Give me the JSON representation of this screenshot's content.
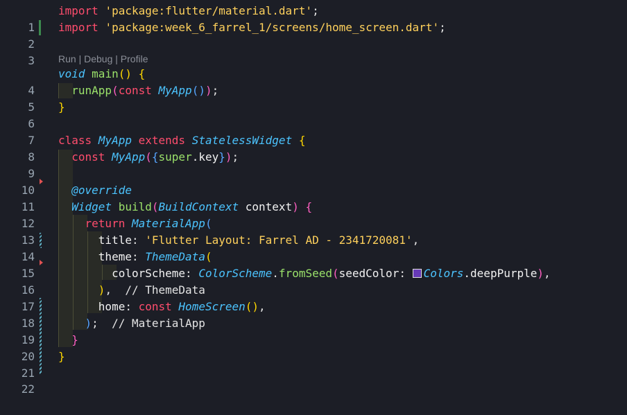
{
  "editor": {
    "line_numbers": [
      "1",
      "2",
      "3",
      "4",
      "5",
      "6",
      "7",
      "8",
      "9",
      "10",
      "11",
      "12",
      "13",
      "14",
      "15",
      "16",
      "17",
      "18",
      "19",
      "20",
      "21",
      "22"
    ],
    "code_lens": {
      "run": "Run",
      "sep1": " | ",
      "debug": "Debug",
      "sep2": " | ",
      "profile": "Profile"
    },
    "tokens": {
      "l1_import": "import",
      "l1_str": "'package:flutter/material.dart'",
      "l1_semi": ";",
      "l2_import": "import",
      "l2_str": "'package:week_6_farrel_1/screens/home_screen.dart'",
      "l2_semi": ";",
      "l4_void": "void",
      "l4_main": "main",
      "l4_parens": "()",
      "l4_brace": "{",
      "l5_runapp": "runApp",
      "l5_p_open": "(",
      "l5_const": "const",
      "l5_myapp": "MyApp",
      "l5_inner": "()",
      "l5_p_close": ")",
      "l5_semi": ";",
      "l6_brace": "}",
      "l8_class": "class",
      "l8_myapp": "MyApp",
      "l8_extends": "extends",
      "l8_sw": "StatelessWidget",
      "l8_brace": "{",
      "l9_const": "const",
      "l9_myapp": "MyApp",
      "l9_p_open": "(",
      "l9_b_open": "{",
      "l9_super": "super",
      "l9_key": ".key",
      "l9_b_close": "}",
      "l9_p_close": ")",
      "l9_semi": ";",
      "l11_override": "@override",
      "l12_widget": "Widget",
      "l12_build": "build",
      "l12_p_open": "(",
      "l12_ctx_type": "BuildContext",
      "l12_ctx": "context",
      "l12_p_close": ")",
      "l12_brace": "{",
      "l13_return": "return",
      "l13_ma": "MaterialApp",
      "l13_p_open": "(",
      "l14_title": "title",
      "l14_colon": ":",
      "l14_str": "'Flutter Layout: Farrel AD - 2341720081'",
      "l14_comma": ",",
      "l15_theme": "theme",
      "l15_colon": ":",
      "l15_td": "ThemeData",
      "l15_p_open": "(",
      "l16_cs": "colorScheme",
      "l16_colon": ":",
      "l16_cs_type": "ColorScheme",
      "l16_dot": ".",
      "l16_fromseed": "fromSeed",
      "l16_p_open": "(",
      "l16_seed": "seedColor",
      "l16_colon2": ":",
      "l16_colors": "Colors",
      "l16_dp": ".deepPurple",
      "l16_p_close": ")",
      "l16_comma": ",",
      "l17_p_close": ")",
      "l17_comma": ",",
      "l17_comment": "// ThemeData",
      "l18_home": "home",
      "l18_colon": ":",
      "l18_const": "const",
      "l18_hs": "HomeScreen",
      "l18_parens": "()",
      "l18_comma": ",",
      "l19_p_close": ")",
      "l19_semi": ";",
      "l19_comment": "// MaterialApp",
      "l20_brace": "}",
      "l21_brace": "}"
    }
  },
  "colors": {
    "background": "#1c1e26",
    "keyword": "#ff4d6d",
    "string": "#ffd15c",
    "function": "#9be26a",
    "type": "#4cc4ff",
    "swatch_deep_purple": "#673ab7"
  }
}
